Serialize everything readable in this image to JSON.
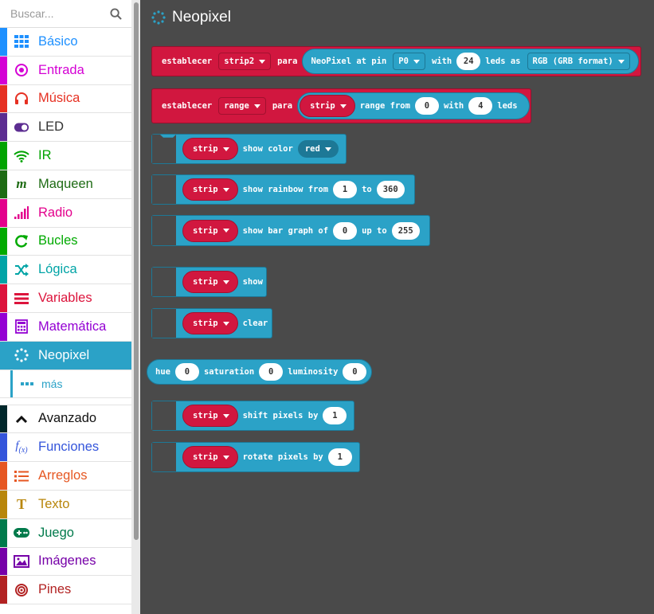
{
  "search": {
    "placeholder": "Buscar..."
  },
  "categories": [
    {
      "label": "Básico",
      "color": "#1e90ff",
      "icon": "grid-icon"
    },
    {
      "label": "Entrada",
      "color": "#d400d4",
      "icon": "target-icon"
    },
    {
      "label": "Música",
      "color": "#e63022",
      "icon": "headphones-icon"
    },
    {
      "label": "LED",
      "color": "#5c2d91",
      "icon": "toggle-icon"
    },
    {
      "label": "IR",
      "color": "#00a300",
      "icon": "wifi-icon"
    },
    {
      "label": "Maqueen",
      "color": "#1e6b14",
      "icon": "m-icon"
    },
    {
      "label": "Radio",
      "color": "#e3008c",
      "icon": "signal-icon"
    },
    {
      "label": "Bucles",
      "color": "#00aa00",
      "icon": "loop-icon"
    },
    {
      "label": "Lógica",
      "color": "#00a4a6",
      "icon": "shuffle-icon"
    },
    {
      "label": "Variables",
      "color": "#dc143c",
      "icon": "lines-icon"
    },
    {
      "label": "Matemática",
      "color": "#9400d3",
      "icon": "calculator-icon"
    },
    {
      "label": "Neopixel",
      "color": "#2ba2c7",
      "icon": "dots-circle-icon"
    },
    {
      "label": "más",
      "color": "#2ba2c7",
      "icon": "ellipsis-icon"
    },
    {
      "label": "Avanzado",
      "color": "#00272b",
      "icon": "chevron-up-icon"
    },
    {
      "label": "Funciones",
      "color": "#3455db",
      "icon": "function-icon"
    },
    {
      "label": "Arreglos",
      "color": "#e65722",
      "icon": "list-icon"
    },
    {
      "label": "Texto",
      "color": "#b8860b",
      "icon": "text-icon"
    },
    {
      "label": "Juego",
      "color": "#007a4b",
      "icon": "gamepad-icon"
    },
    {
      "label": "Imágenes",
      "color": "#7600a8",
      "icon": "image-icon"
    },
    {
      "label": "Pines",
      "color": "#b22222",
      "icon": "pin-icon"
    }
  ],
  "flyout": {
    "title": "Neopixel",
    "b1": {
      "set": "establecer",
      "var": "strip2",
      "para": "para",
      "np": "NeoPixel at pin",
      "pin": "P0",
      "with": "with",
      "num": "24",
      "leds_as": "leds as",
      "fmt": "RGB (GRB format)"
    },
    "b2": {
      "set": "establecer",
      "var": "range",
      "para": "para",
      "strip": "strip",
      "range_from": "range from",
      "from": "0",
      "with": "with",
      "count": "4",
      "leds": "leds"
    },
    "b3": {
      "strip": "strip",
      "label": "show color",
      "color": "red"
    },
    "b4": {
      "strip": "strip",
      "label": "show rainbow from",
      "from": "1",
      "to": "to",
      "end": "360"
    },
    "b5": {
      "strip": "strip",
      "label": "show bar graph of",
      "val": "0",
      "up_to": "up to",
      "max": "255"
    },
    "b6": {
      "strip": "strip",
      "label": "show"
    },
    "b7": {
      "strip": "strip",
      "label": "clear"
    },
    "b8": {
      "hue": "hue",
      "hue_val": "0",
      "sat": "saturation",
      "sat_val": "0",
      "lum": "luminosity",
      "lum_val": "0"
    },
    "b9": {
      "strip": "strip",
      "label": "shift pixels by",
      "val": "1"
    },
    "b10": {
      "strip": "strip",
      "label": "rotate pixels by",
      "val": "1"
    }
  }
}
